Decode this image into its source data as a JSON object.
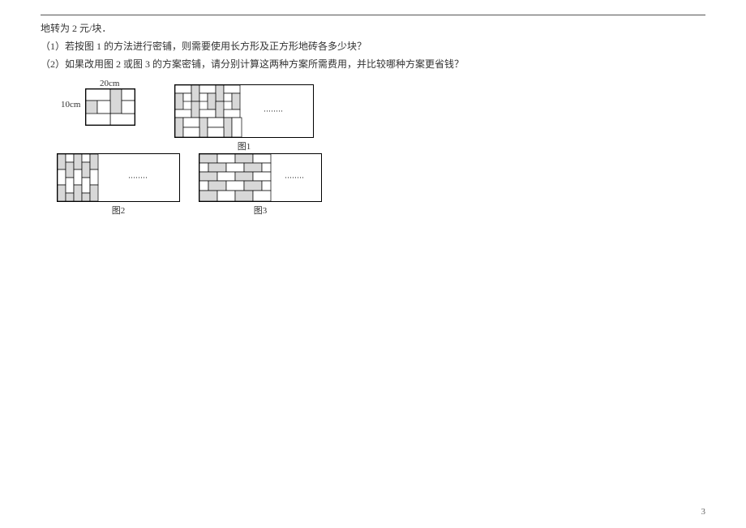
{
  "lines": {
    "l0": "地转为 2 元/块．",
    "l1": "（1）若按图 1 的方法进行密铺，则需要使用长方形及正方形地砖各多少块？",
    "l2": "（2）如果改用图 2 或图 3 的方案密铺，请分别计算这两种方案所需费用，并比较哪种方案更省钱？"
  },
  "dims": {
    "top": "20cm",
    "left": "10cm"
  },
  "labels": {
    "fig1": "图1",
    "fig2": "图2",
    "fig3": "图3",
    "ellipsis": "········"
  },
  "page": "3"
}
